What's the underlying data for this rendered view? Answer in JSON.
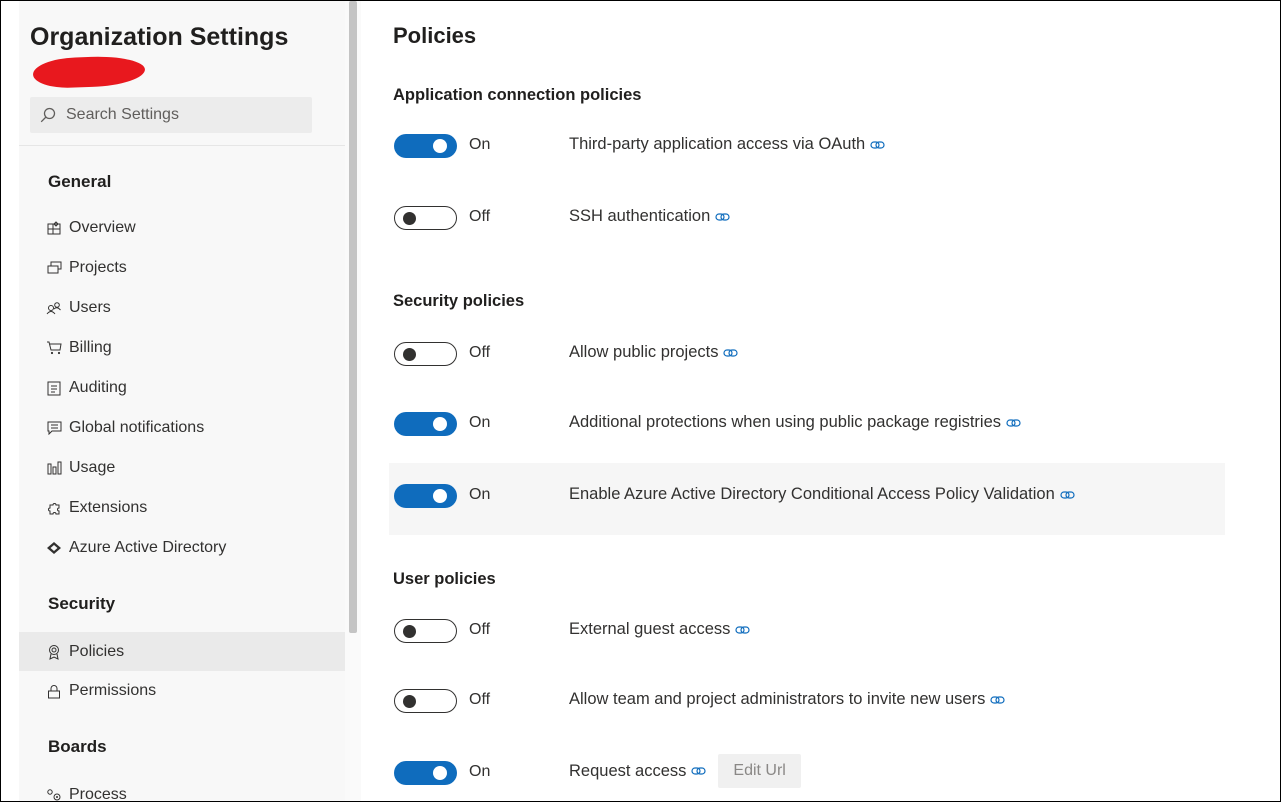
{
  "sidebar": {
    "title": "Organization Settings",
    "search_placeholder": "Search Settings",
    "groups": [
      {
        "label": "General"
      },
      {
        "label": "Security"
      },
      {
        "label": "Boards"
      }
    ],
    "items": [
      {
        "label": "Overview",
        "icon": "overview-icon"
      },
      {
        "label": "Projects",
        "icon": "projects-icon"
      },
      {
        "label": "Users",
        "icon": "users-icon"
      },
      {
        "label": "Billing",
        "icon": "cart-icon"
      },
      {
        "label": "Auditing",
        "icon": "audit-log-icon"
      },
      {
        "label": "Global notifications",
        "icon": "chat-icon"
      },
      {
        "label": "Usage",
        "icon": "usage-chart-icon"
      },
      {
        "label": "Extensions",
        "icon": "puzzle-icon"
      },
      {
        "label": "Azure Active Directory",
        "icon": "aad-diamond-icon"
      },
      {
        "label": "Policies",
        "icon": "ribbon-icon",
        "selected": true
      },
      {
        "label": "Permissions",
        "icon": "lock-icon"
      },
      {
        "label": "Process",
        "icon": "process-icon"
      }
    ]
  },
  "main": {
    "title": "Policies",
    "sections": [
      {
        "heading": "Application connection policies",
        "policies": [
          {
            "state": "On",
            "label": "Third-party application access via OAuth",
            "enabled": true
          },
          {
            "state": "Off",
            "label": "SSH authentication",
            "enabled": false
          }
        ]
      },
      {
        "heading": "Security policies",
        "policies": [
          {
            "state": "Off",
            "label": "Allow public projects",
            "enabled": false
          },
          {
            "state": "On",
            "label": "Additional protections when using public package registries",
            "enabled": true
          },
          {
            "state": "On",
            "label": "Enable Azure Active Directory Conditional Access Policy Validation",
            "enabled": true
          }
        ]
      },
      {
        "heading": "User policies",
        "policies": [
          {
            "state": "Off",
            "label": "External guest access",
            "enabled": false
          },
          {
            "state": "Off",
            "label": "Allow team and project administrators to invite new users",
            "enabled": false
          },
          {
            "state": "On",
            "label": "Request access",
            "enabled": true,
            "button": "Edit Url"
          }
        ]
      }
    ]
  },
  "colors": {
    "accent": "#0f6cbd",
    "redaction": "#e8181e",
    "sidebar_bg": "#f8f8f8",
    "selected_bg": "#eaeaea"
  }
}
